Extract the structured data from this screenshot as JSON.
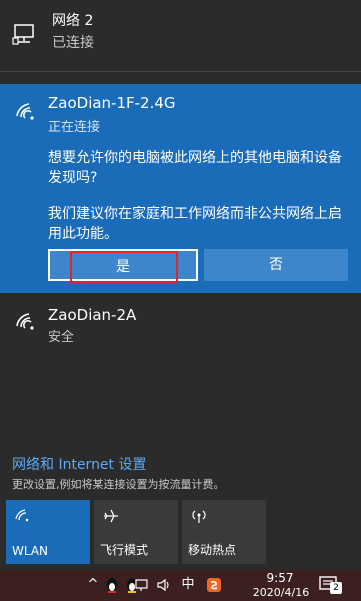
{
  "network2": {
    "name": "网络 2",
    "status": "已连接"
  },
  "active_network": {
    "ssid": "ZaoDian-1F-2.4G",
    "status": "正在连接",
    "question": "想要允许你的电脑被此网络上的其他电脑和设备发现吗?",
    "recommendation": "我们建议你在家庭和工作网络而非公共网络上启用此功能。",
    "yes_label": "是",
    "no_label": "否"
  },
  "other_network": {
    "ssid": "ZaoDian-2A",
    "security": "安全"
  },
  "settings": {
    "link": "网络和 Internet 设置",
    "sub": "更改设置,例如将某连接设置为按流量计费。"
  },
  "tiles": [
    {
      "label": "WLAN",
      "icon": "wifi-icon"
    },
    {
      "label": "飞行模式",
      "icon": "airplane-icon"
    },
    {
      "label": "移动热点",
      "icon": "hotspot-icon"
    }
  ],
  "taskbar": {
    "ime_label": "中",
    "time": "9:57",
    "date": "2020/4/16",
    "notification_count": "2"
  },
  "colors": {
    "accent": "#1a6bb8",
    "highlight": "#e0262b",
    "panel": "#2b2b2b"
  }
}
